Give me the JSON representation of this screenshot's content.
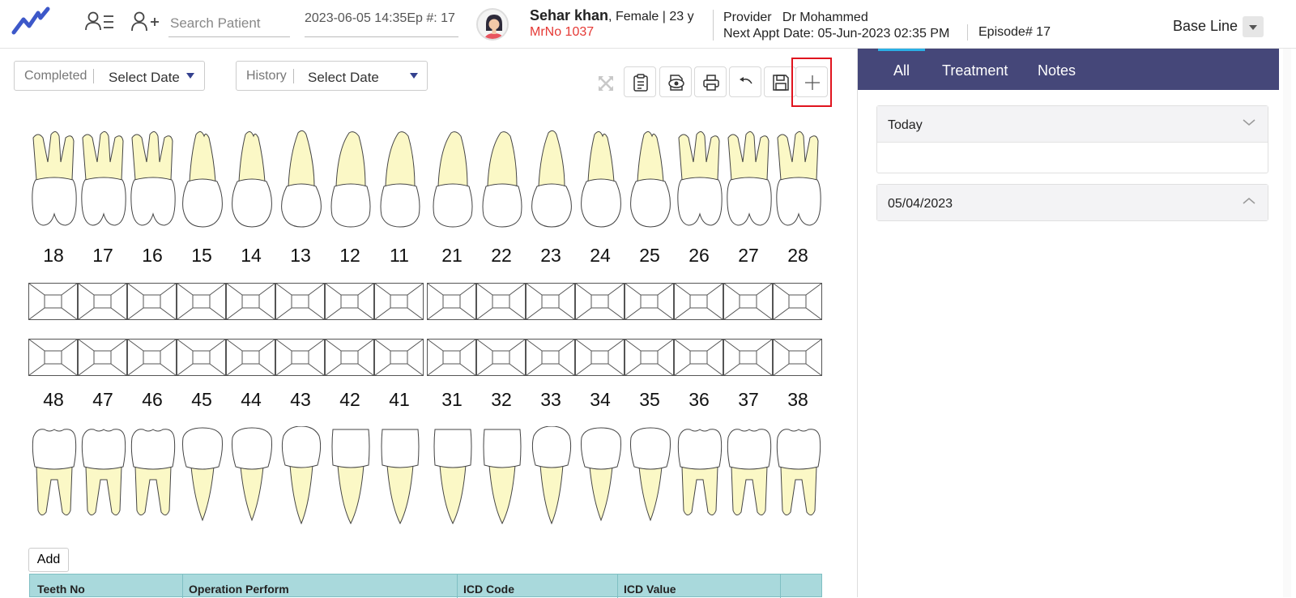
{
  "header": {
    "search_placeholder": "Search Patient",
    "datetime": "2023-06-05 14:35",
    "episode_short": "Ep #: 17",
    "patient_name": "Sehar khan",
    "patient_info": ", Female | 23 y",
    "mrno": "MrNo 1037",
    "provider_label": "Provider",
    "provider_name": "Dr Mohammed",
    "next_appt_label": "Next Appt Date:",
    "next_appt_value": "05-Jun-2023 02:35 PM",
    "episode": "Episode# 17",
    "baseline": "Base Line"
  },
  "filters": {
    "completed_label": "Completed",
    "completed_value": "Select Date",
    "history_label": "History",
    "history_value": "Select Date"
  },
  "toolbar": {
    "icons": [
      "expand-icon",
      "clipboard-icon",
      "preview-icon",
      "print-icon",
      "undo-icon",
      "save-icon",
      "add-icon"
    ]
  },
  "chart": {
    "upper_numbers": [
      "18",
      "17",
      "16",
      "15",
      "14",
      "13",
      "12",
      "11",
      "21",
      "22",
      "23",
      "24",
      "25",
      "26",
      "27",
      "28"
    ],
    "lower_numbers": [
      "48",
      "47",
      "46",
      "45",
      "44",
      "43",
      "42",
      "41",
      "31",
      "32",
      "33",
      "34",
      "35",
      "36",
      "37",
      "38"
    ]
  },
  "table": {
    "add_label": "Add",
    "columns": [
      "Teeth No",
      "Operation Perform",
      "ICD Code",
      "ICD Value"
    ]
  },
  "right_panel": {
    "tabs": [
      "All",
      "Treatment",
      "Notes"
    ],
    "active_tab": "All",
    "sections": [
      {
        "title": "Today",
        "expanded": true
      },
      {
        "title": "05/04/2023",
        "expanded": false
      }
    ]
  },
  "colors": {
    "accent": "#454779",
    "root": "#fbf8c6",
    "alert": "#e53935",
    "table_header": "#a9d9dc"
  }
}
